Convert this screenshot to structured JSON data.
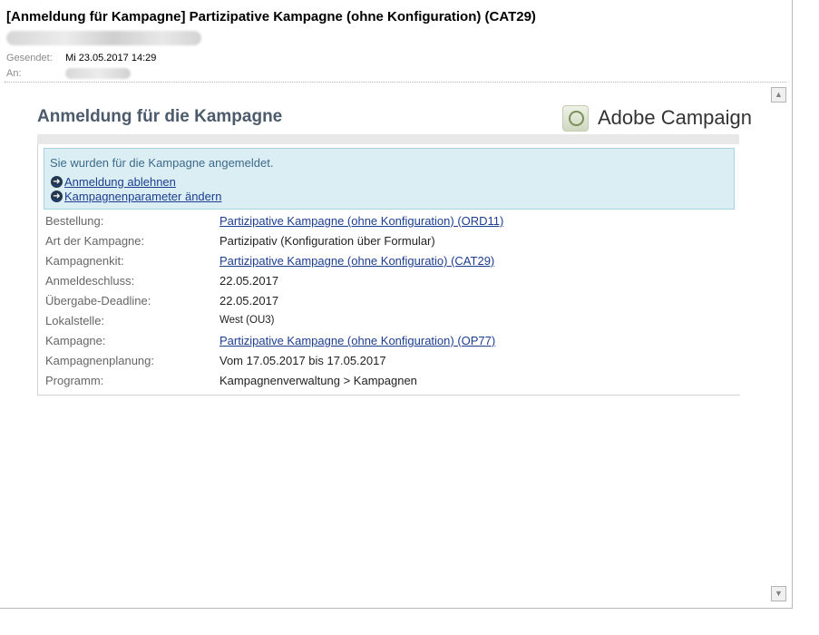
{
  "email": {
    "subject": "[Anmeldung für Kampagne] Partizipative Kampagne (ohne Konfiguration)  (CAT29)",
    "from_blurred": "",
    "sent_label": "Gesendet:",
    "sent_value": "Mi 23.05.2017 14:29",
    "to_label": "An:",
    "to_blurred": ""
  },
  "content": {
    "title": "Anmeldung für die Kampagne",
    "logo_text": "Adobe Campaign",
    "notice": {
      "message": "Sie wurden für die Kampagne angemeldet.",
      "links": [
        "Anmeldung ablehnen",
        "Kampagnenparameter ändern"
      ]
    },
    "rows": [
      {
        "label": "Bestellung:",
        "value": "Partizipative Kampagne (ohne Konfiguration) (ORD11)"
      },
      {
        "label": "Art der Kampagne:",
        "value": "Partizipativ (Konfiguration über Formular)"
      },
      {
        "label": "Kampagnenkit:",
        "value": "Partizipative Kampagne (ohne Konfiguratio) (CAT29)"
      },
      {
        "label": "Anmeldeschluss:",
        "value": "22.05.2017"
      },
      {
        "label": "Übergabe-Deadline:",
        "value": "22.05.2017"
      },
      {
        "label": "Lokalstelle:",
        "value": "West (OU3)"
      },
      {
        "label": "Kampagne:",
        "value": "Partizipative Kampagne (ohne Konfiguration) (OP77)"
      },
      {
        "label": "Kampagnenplanung:",
        "value": "Vom 17.05.2017 bis 17.05.2017"
      },
      {
        "label": "Programm:",
        "value": "Kampagnenverwaltung > Kampagnen"
      }
    ]
  },
  "icons": {
    "arrow": "circle-arrow-right-icon",
    "scroll_up": "scroll-up-icon",
    "scroll_down": "scroll-down-icon",
    "logo": "adobe-campaign-logo-icon"
  },
  "colors": {
    "title": "#4c5b6b",
    "link": "#1c3d8f",
    "notice_bg": "#dbeef4",
    "notice_border": "#a9d2e1"
  }
}
